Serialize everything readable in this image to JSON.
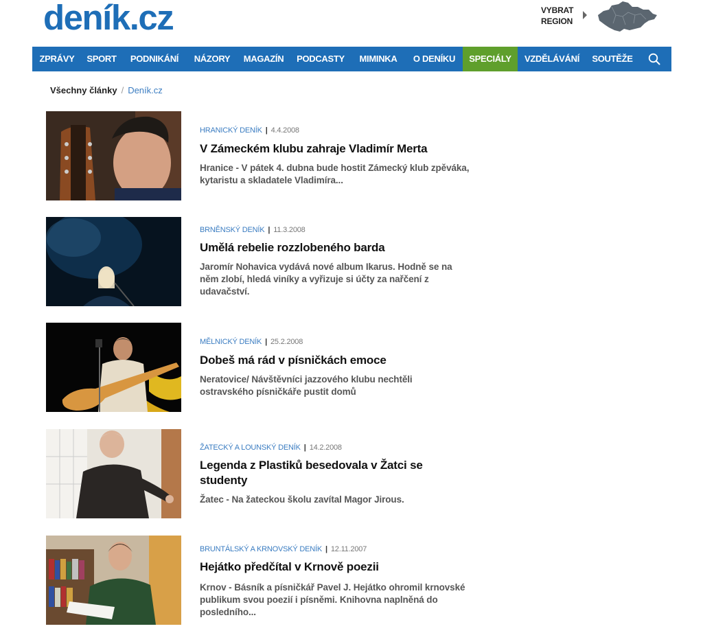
{
  "header": {
    "logo": "deník.cz",
    "region_line1": "VYBRAT",
    "region_line2": "REGION",
    "map_icon": "czech-map-icon"
  },
  "nav": {
    "items": [
      {
        "label": "ZPRÁVY"
      },
      {
        "label": "SPORT"
      },
      {
        "label": "PODNIKÁNÍ"
      },
      {
        "label": "NÁZORY"
      },
      {
        "label": "MAGAZÍN"
      },
      {
        "label": "PODCASTY"
      },
      {
        "label": "MIMINKA"
      },
      {
        "label": "O DENÍKU"
      },
      {
        "label": "SPECIÁLY",
        "active": true
      },
      {
        "label": "VZDĚLÁVÁNÍ"
      },
      {
        "label": "SOUTĚŽE"
      }
    ],
    "search_icon": "search-icon"
  },
  "colors": {
    "brand": "#1e6eb7",
    "active_nav": "#5f9f2c",
    "source_link": "#3a7cc1"
  },
  "breadcrumb": {
    "first": "Všechny články",
    "separator": "/",
    "current": "Deník.cz"
  },
  "articles": [
    {
      "source": "Hranický deník",
      "date": "4.4.2008",
      "title": "V Zámeckém klubu zahraje Vladimír Merta",
      "perex": "Hranice - V pátek 4. dubna bude hostit Zámecký klub zpěváka, kytaristu a skladatele Vladimíra..."
    },
    {
      "source": "Brněnský deník",
      "date": "11.3.2008",
      "title": "Umělá rebelie rozzlobeného barda",
      "perex": "Jaromír Nohavica vydává nové album Ikarus. Hodně se na něm zlobí, hledá viníky a vyřizuje si účty za nařčení z udavačství."
    },
    {
      "source": "Mělnický deník",
      "date": "25.2.2008",
      "title": "Dobeš má rád v písničkách emoce",
      "perex": "Neratovice/ Návštěvníci jazzového klubu nechtěli ostravského písničkáře pustit domů"
    },
    {
      "source": "Žatecký a lounský deník",
      "date": "14.2.2008",
      "title": "Legenda z Plastiků besedovala v Žatci se studenty",
      "perex": "Žatec - Na žateckou školu zavítal Magor Jirous."
    },
    {
      "source": "Bruntálský a krnovský deník",
      "date": "12.11.2007",
      "title": "Hejátko předčítal v Krnově poezii",
      "perex": "Krnov - Básník a písničkář Pavel J. Hejátko ohromil krnovské publikum svou poezií i písněmi. Knihovna naplněná do posledního..."
    }
  ]
}
